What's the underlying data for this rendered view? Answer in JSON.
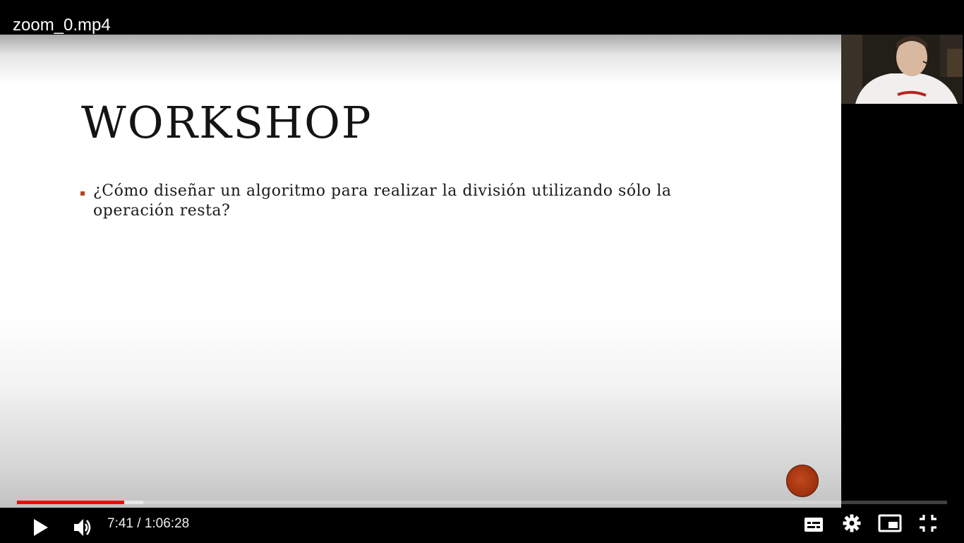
{
  "player": {
    "file_title": "zoom_0.mp4",
    "current_time": "7:41",
    "time_separator": " / ",
    "duration": "1:06:28",
    "progress_fraction": 0.1156,
    "buffered_fraction": 0.136,
    "accent_color": "#ff0000"
  },
  "slide": {
    "title": "WORKSHOP",
    "bullet": "¿Cómo diseñar un algoritmo para realizar la división utilizando sólo la operación resta?",
    "bullet_marker_color": "#b8451c"
  },
  "controls": {
    "icons": [
      "play-icon",
      "volume-icon",
      "subtitles-icon",
      "settings-icon",
      "miniplayer-icon",
      "exit-fullscreen-icon"
    ]
  }
}
